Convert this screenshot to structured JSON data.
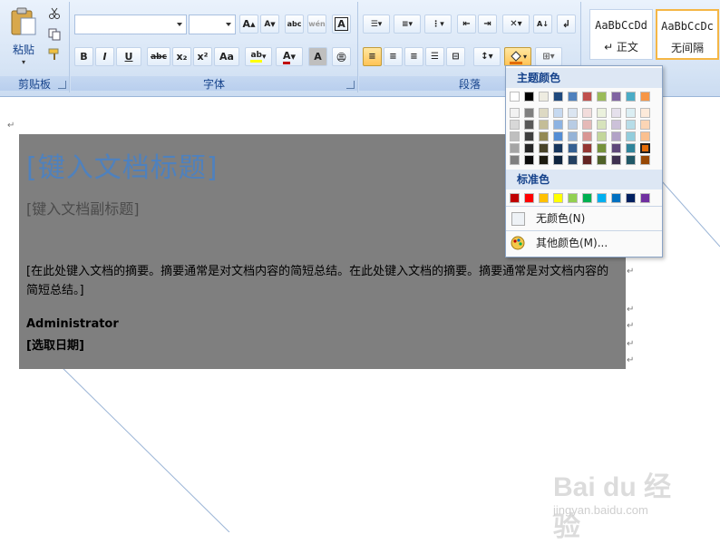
{
  "ribbon": {
    "clipboard": {
      "paste_label": "粘贴",
      "group_label": "剪贴板"
    },
    "font": {
      "group_label": "字体",
      "bold": "B",
      "italic": "I",
      "underline": "U",
      "strike": "abc",
      "sub": "x₂",
      "sup": "x²",
      "case": "Aa",
      "grow": "A",
      "shrink": "A",
      "text_a": "A"
    },
    "paragraph": {
      "group_label": "段落"
    },
    "styles": [
      {
        "sample": "AaBbCcDd",
        "name": "↵ 正文"
      },
      {
        "sample": "AaBbCcDc",
        "name": "无间隔"
      }
    ]
  },
  "colors": {
    "accent": "#4f81bd",
    "highlight_active": "#ffc456",
    "selection_bg": "#7f7f7f"
  },
  "shading_menu": {
    "theme_header": "主题颜色",
    "standard_header": "标准色",
    "no_color": "无颜色(N)",
    "more_colors": "其他颜色(M)...",
    "theme_top": [
      "#ffffff",
      "#000000",
      "#eeece1",
      "#1f497d",
      "#4f81bd",
      "#c0504d",
      "#9bbb59",
      "#8064a2",
      "#4bacc6",
      "#f79646"
    ],
    "theme_shades": [
      [
        "#f2f2f2",
        "#7f7f7f",
        "#ddd9c3",
        "#c6d9f0",
        "#dbe5f1",
        "#f2dcdb",
        "#ebf1dd",
        "#e5e0ec",
        "#dbeef3",
        "#fdeada"
      ],
      [
        "#d8d8d8",
        "#595959",
        "#c4bd97",
        "#8db3e2",
        "#b8cce4",
        "#e5b9b7",
        "#d7e3bc",
        "#ccc1d9",
        "#b7dde8",
        "#fbd5b5"
      ],
      [
        "#bfbfbf",
        "#3f3f3f",
        "#938953",
        "#548dd4",
        "#95b3d7",
        "#d99694",
        "#c3d69b",
        "#b2a2c7",
        "#92cddc",
        "#fac08f"
      ],
      [
        "#a5a5a5",
        "#262626",
        "#494429",
        "#17365d",
        "#366092",
        "#953734",
        "#76923c",
        "#5f497a",
        "#31859b",
        "#e36c09"
      ],
      [
        "#7f7f7f",
        "#0c0c0c",
        "#1d1b10",
        "#0f243e",
        "#244061",
        "#632423",
        "#4f6128",
        "#3f3151",
        "#205867",
        "#974806"
      ]
    ],
    "standard": [
      "#c00000",
      "#ff0000",
      "#ffc000",
      "#ffff00",
      "#92d050",
      "#00b050",
      "#00b0f0",
      "#0070c0",
      "#002060",
      "#7030a0"
    ]
  },
  "document": {
    "title": "[键入文档标题]",
    "subtitle": "[键入文档副标题]",
    "abstract": "[在此处键入文档的摘要。摘要通常是对文档内容的简短总结。在此处键入文档的摘要。摘要通常是对文档内容的简短总结。]",
    "author": "Administrator",
    "date": "[选取日期]"
  },
  "watermark": {
    "brand": "Bai du 经验",
    "url": "jingyan.baidu.com"
  }
}
